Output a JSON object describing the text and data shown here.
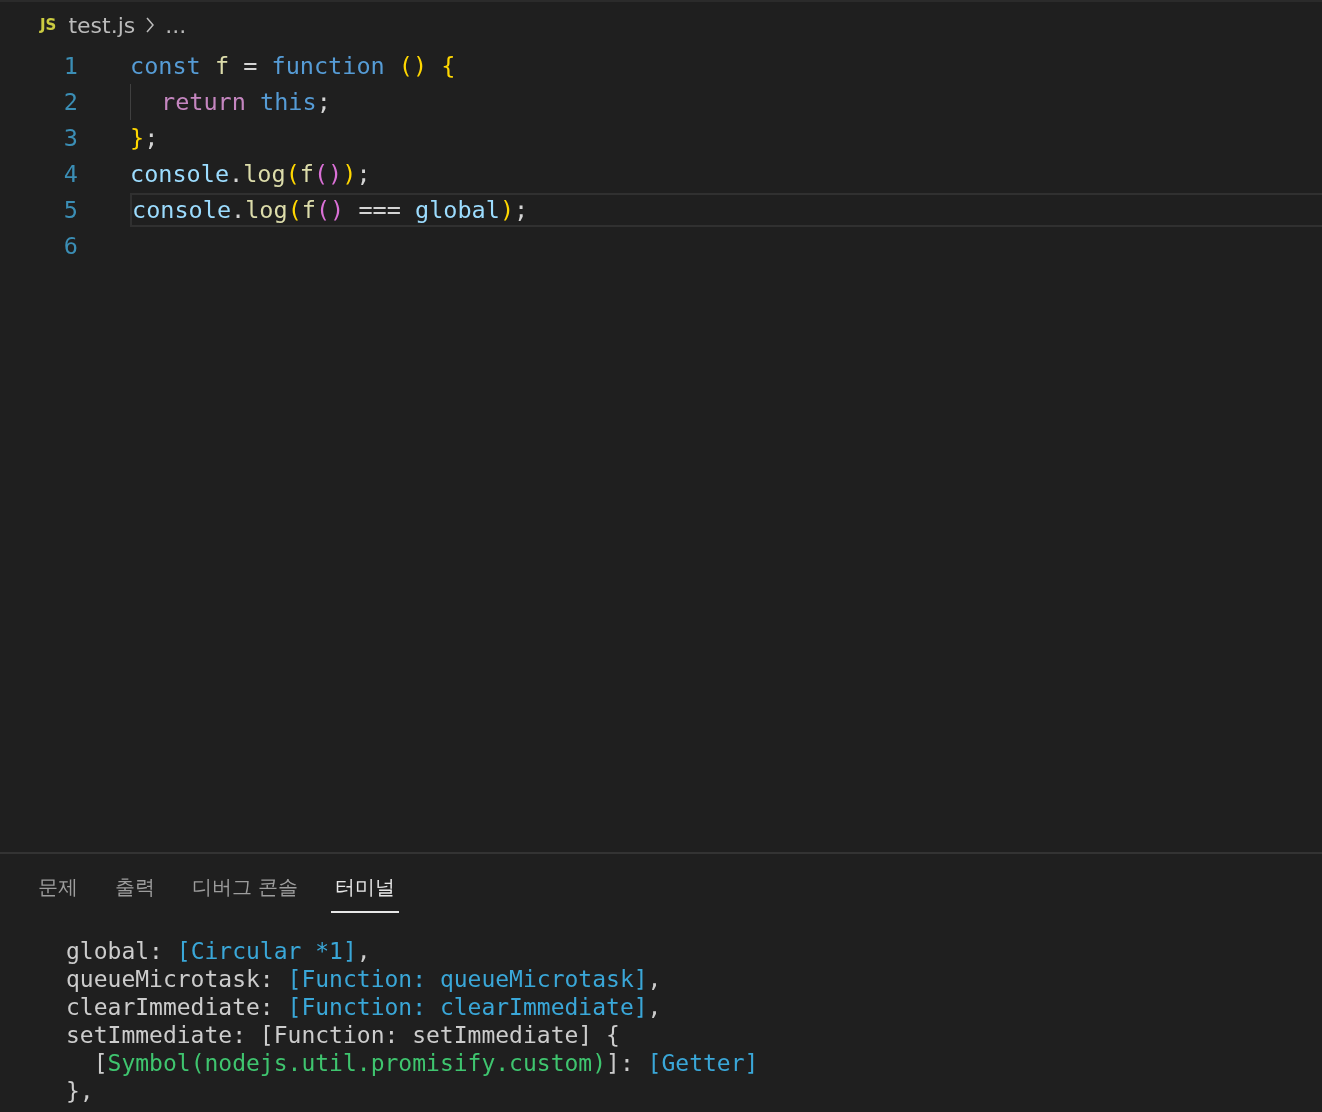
{
  "breadcrumb": {
    "file_icon": "JS",
    "file": "test.js",
    "more": "..."
  },
  "editor": {
    "lines": [
      {
        "number": "1",
        "current": false,
        "indent_guide": false,
        "tokens": [
          {
            "kind": "keyword",
            "text": "const"
          },
          {
            "kind": "name",
            "text": " f"
          },
          {
            "kind": "plain",
            "text": " = "
          },
          {
            "kind": "keyword",
            "text": "function"
          },
          {
            "kind": "bracket1",
            "text": " () {"
          }
        ]
      },
      {
        "number": "2",
        "current": false,
        "indent_guide": true,
        "tokens": [
          {
            "kind": "control",
            "text": "return"
          },
          {
            "kind": "keyword",
            "text": " this"
          },
          {
            "kind": "plain",
            "text": ";"
          }
        ]
      },
      {
        "number": "3",
        "current": false,
        "indent_guide": false,
        "tokens": [
          {
            "kind": "bracket1",
            "text": "}"
          },
          {
            "kind": "plain",
            "text": ";"
          }
        ]
      },
      {
        "number": "4",
        "current": false,
        "indent_guide": false,
        "tokens": [
          {
            "kind": "variable",
            "text": "console"
          },
          {
            "kind": "plain",
            "text": "."
          },
          {
            "kind": "name",
            "text": "log"
          },
          {
            "kind": "bracket1",
            "text": "("
          },
          {
            "kind": "name",
            "text": "f"
          },
          {
            "kind": "bracket2",
            "text": "()"
          },
          {
            "kind": "bracket1",
            "text": ")"
          },
          {
            "kind": "plain",
            "text": ";"
          }
        ]
      },
      {
        "number": "5",
        "current": true,
        "indent_guide": false,
        "tokens": [
          {
            "kind": "variable",
            "text": "console"
          },
          {
            "kind": "plain",
            "text": "."
          },
          {
            "kind": "name",
            "text": "log"
          },
          {
            "kind": "bracket1",
            "text": "("
          },
          {
            "kind": "name",
            "text": "f"
          },
          {
            "kind": "bracket2",
            "text": "()"
          },
          {
            "kind": "plain",
            "text": " === "
          },
          {
            "kind": "variable",
            "text": "global"
          },
          {
            "kind": "bracket1",
            "text": ")"
          },
          {
            "kind": "plain",
            "text": ";"
          }
        ]
      },
      {
        "number": "6",
        "current": false,
        "indent_guide": false
      }
    ]
  },
  "panel": {
    "tabs": [
      {
        "label": "문제",
        "selected": false
      },
      {
        "label": "출력",
        "selected": false
      },
      {
        "label": "디버그 콘솔",
        "selected": false
      },
      {
        "label": "터미널",
        "selected": true
      }
    ],
    "terminal_lines": [
      [
        {
          "kind": "plain",
          "text": "global: "
        },
        {
          "kind": "special",
          "text": "[Circular *1]"
        },
        {
          "kind": "plain",
          "text": ","
        }
      ],
      [
        {
          "kind": "plain",
          "text": "queueMicrotask: "
        },
        {
          "kind": "special",
          "text": "[Function: queueMicrotask]"
        },
        {
          "kind": "plain",
          "text": ","
        }
      ],
      [
        {
          "kind": "plain",
          "text": "clearImmediate: "
        },
        {
          "kind": "special",
          "text": "[Function: clearImmediate]"
        },
        {
          "kind": "plain",
          "text": ","
        }
      ],
      [
        {
          "kind": "plain",
          "text": "setImmediate: [Function: setImmediate] {"
        }
      ],
      [
        {
          "kind": "plain",
          "text": "  ["
        },
        {
          "kind": "symbol",
          "text": "Symbol(nodejs.util.promisify.custom)"
        },
        {
          "kind": "plain",
          "text": "]: "
        },
        {
          "kind": "special",
          "text": "[Getter]"
        }
      ],
      [
        {
          "kind": "plain",
          "text": "},"
        }
      ]
    ]
  }
}
